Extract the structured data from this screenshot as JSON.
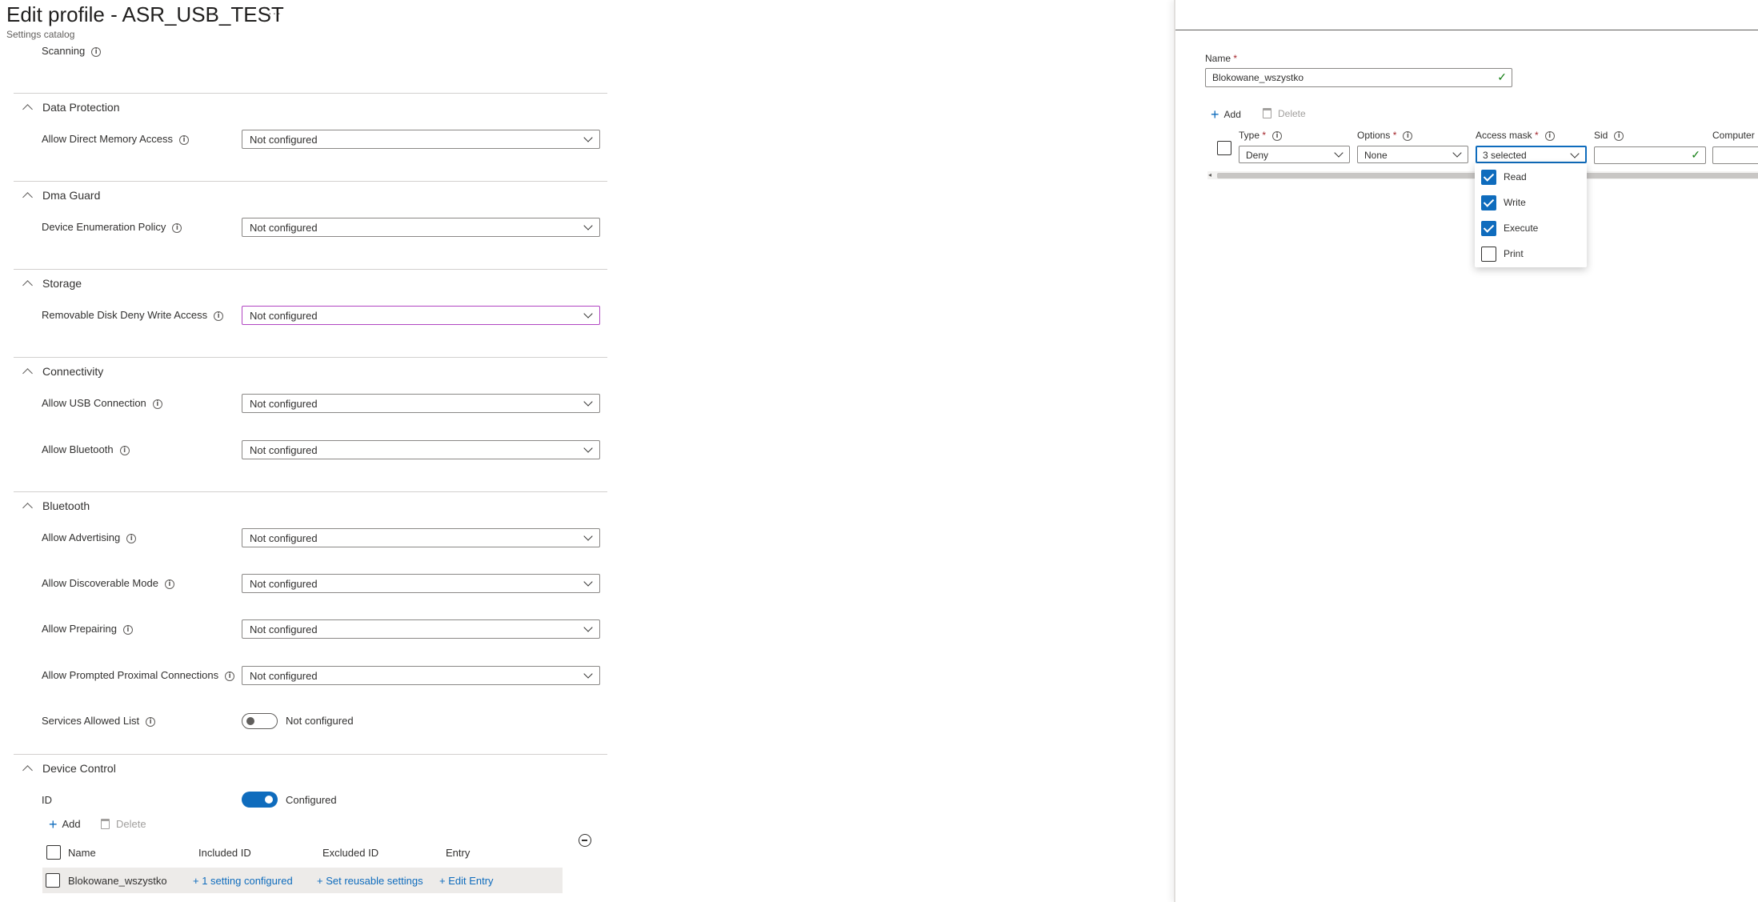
{
  "header": {
    "title": "Edit profile - ASR_USB_TEST",
    "more": "···",
    "subtitle": "Settings catalog"
  },
  "scanning_label": "Scanning",
  "sections": {
    "data_protection": {
      "title": "Data Protection",
      "allow_dma_label": "Allow Direct Memory Access",
      "allow_dma_value": "Not configured"
    },
    "dma_guard": {
      "title": "Dma Guard",
      "enum_label": "Device Enumeration Policy",
      "enum_value": "Not configured"
    },
    "storage": {
      "title": "Storage",
      "deny_write_label": "Removable Disk Deny Write Access",
      "deny_write_value": "Not configured"
    },
    "connectivity": {
      "title": "Connectivity",
      "usb_label": "Allow USB Connection",
      "usb_value": "Not configured",
      "bt_label": "Allow Bluetooth",
      "bt_value": "Not configured"
    },
    "bluetooth": {
      "title": "Bluetooth",
      "adv_label": "Allow Advertising",
      "adv_value": "Not configured",
      "disc_label": "Allow Discoverable Mode",
      "disc_value": "Not configured",
      "pair_label": "Allow Prepairing",
      "pair_value": "Not configured",
      "prox_label": "Allow Prompted Proximal Connections",
      "prox_value": "Not configured",
      "svc_label": "Services Allowed List",
      "svc_toggle_text": "Not configured"
    },
    "device_control": {
      "title": "Device Control",
      "id_label": "ID",
      "id_toggle_text": "Configured",
      "add_label": "Add",
      "delete_label": "Delete",
      "columns": {
        "name": "Name",
        "included": "Included ID",
        "excluded": "Excluded ID",
        "entry": "Entry"
      },
      "row": {
        "name": "Blokowane_wszystko",
        "included": "+ 1 setting configured",
        "excluded": "+ Set reusable settings",
        "entry": "+ Edit Entry"
      }
    }
  },
  "panel": {
    "name_label": "Name",
    "required_mark": "*",
    "name_value": "Blokowane_wszystko",
    "add_label": "Add",
    "delete_label": "Delete",
    "columns": {
      "type": "Type",
      "options": "Options",
      "access_mask": "Access mask",
      "sid": "Sid",
      "computer": "Computer"
    },
    "row": {
      "type": "Deny",
      "options": "None",
      "access_mask": "3 selected",
      "sid": ""
    },
    "access_options": [
      {
        "label": "Read",
        "checked": true
      },
      {
        "label": "Write",
        "checked": true
      },
      {
        "label": "Execute",
        "checked": true
      },
      {
        "label": "Print",
        "checked": false
      }
    ]
  }
}
